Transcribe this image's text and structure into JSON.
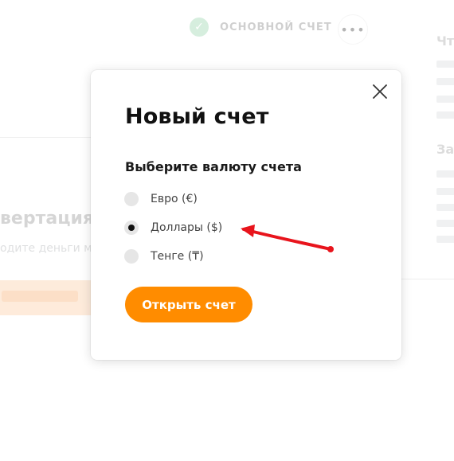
{
  "background": {
    "account_label": "ОСНОВНОЙ СЧЕТ",
    "more_glyph": "•••",
    "check_glyph": "✓",
    "side_heading_1": "Чт",
    "side_heading_2": "За",
    "conversion_title": "вертация",
    "conversion_subtitle": "одите деньги м"
  },
  "modal": {
    "title": "Новый счет",
    "section_label": "Выберите валюту счета",
    "currency_options": [
      {
        "label": "Евро (€)",
        "selected": false
      },
      {
        "label": "Доллары ($)",
        "selected": true
      },
      {
        "label": "Тенге (₸)",
        "selected": false
      }
    ],
    "submit_label": "Открыть счет",
    "close_icon": "close-icon"
  },
  "colors": {
    "accent": "#ff8c00",
    "annotation": "#e8141c",
    "radio_unselected": "#e6e6e6",
    "radio_selected_dot": "#111111"
  }
}
